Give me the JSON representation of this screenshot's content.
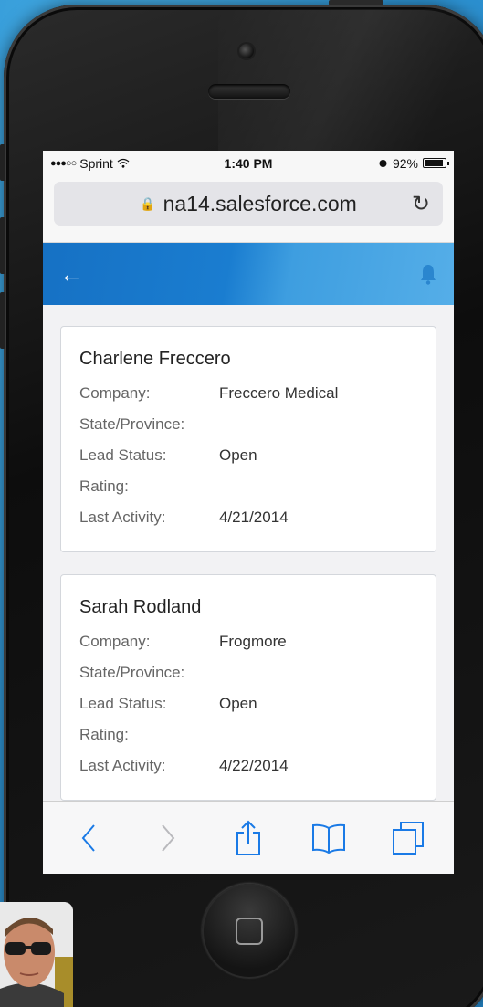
{
  "status_bar": {
    "signal": "●●●○○",
    "carrier": "Sprint",
    "time": "1:40 PM",
    "battery": "92%",
    "battery_level": 0.92
  },
  "browser": {
    "url": "na14.salesforce.com"
  },
  "leads": [
    {
      "name": "Charlene Freccero",
      "fields": [
        {
          "label": "Company:",
          "value": "Freccero Medical"
        },
        {
          "label": "State/Province:",
          "value": ""
        },
        {
          "label": "Lead Status:",
          "value": "Open"
        },
        {
          "label": "Rating:",
          "value": ""
        },
        {
          "label": "Last Activity:",
          "value": "4/21/2014"
        }
      ]
    },
    {
      "name": "Sarah Rodland",
      "fields": [
        {
          "label": "Company:",
          "value": "Frogmore"
        },
        {
          "label": "State/Province:",
          "value": ""
        },
        {
          "label": "Lead Status:",
          "value": "Open"
        },
        {
          "label": "Rating:",
          "value": ""
        },
        {
          "label": "Last Activity:",
          "value": "4/22/2014"
        }
      ]
    }
  ],
  "colors": {
    "background": "#2f95d4",
    "header_blue": "#1671c4",
    "toolbar_icon": "#1a7ae6"
  },
  "icons": [
    "back-arrow-icon",
    "bell-icon",
    "lock-icon",
    "reload-icon",
    "wifi-icon",
    "alarm-icon",
    "battery-icon",
    "chevron-left-icon",
    "chevron-right-icon",
    "share-icon",
    "bookmarks-icon",
    "tabs-icon"
  ]
}
